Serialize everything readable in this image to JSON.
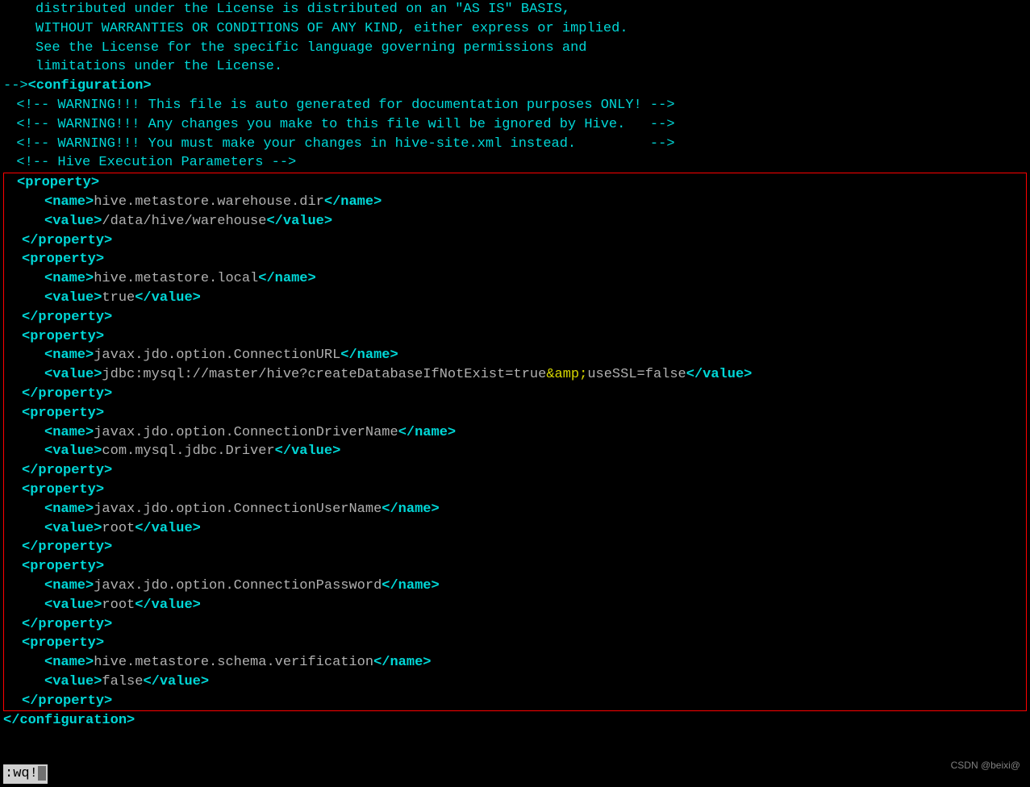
{
  "license": {
    "line1": "distributed under the License is distributed on an \"AS IS\" BASIS,",
    "line2": "WITHOUT WARRANTIES OR CONDITIONS OF ANY KIND, either express or implied.",
    "line3": "See the License for the specific language governing permissions and",
    "line4": "limitations under the License."
  },
  "comment_prefix": "-->",
  "tags": {
    "configuration_open": "<configuration>",
    "configuration_close": "</configuration>",
    "property_open": "<property>",
    "property_close": "</property>",
    "name_open": "<name>",
    "name_close": "</name>",
    "value_open": "<value>",
    "value_close": "</value>"
  },
  "warnings": {
    "w1": "<!-- WARNING!!! This file is auto generated for documentation purposes ONLY! -->",
    "w2": "<!-- WARNING!!! Any changes you make to this file will be ignored by Hive.   -->",
    "w3": "<!-- WARNING!!! You must make your changes in hive-site.xml instead.         -->",
    "w4": "<!-- Hive Execution Parameters -->"
  },
  "properties": [
    {
      "name": "hive.metastore.warehouse.dir",
      "value": "/data/hive/warehouse"
    },
    {
      "name": "hive.metastore.local",
      "value": "true"
    },
    {
      "name": "javax.jdo.option.ConnectionURL",
      "value_prefix": "jdbc:mysql://master/hive?createDatabaseIfNotExist=true",
      "value_entity": "&amp;",
      "value_suffix": "useSSL=false"
    },
    {
      "name": "javax.jdo.option.ConnectionDriverName",
      "value": "com.mysql.jdbc.Driver"
    },
    {
      "name": "javax.jdo.option.ConnectionUserName",
      "value": "root"
    },
    {
      "name": "javax.jdo.option.ConnectionPassword",
      "value": "root"
    },
    {
      "name": "hive.metastore.schema.verification",
      "value": "false"
    }
  ],
  "vim_command": ":wq!",
  "watermark": "CSDN @beixi@"
}
